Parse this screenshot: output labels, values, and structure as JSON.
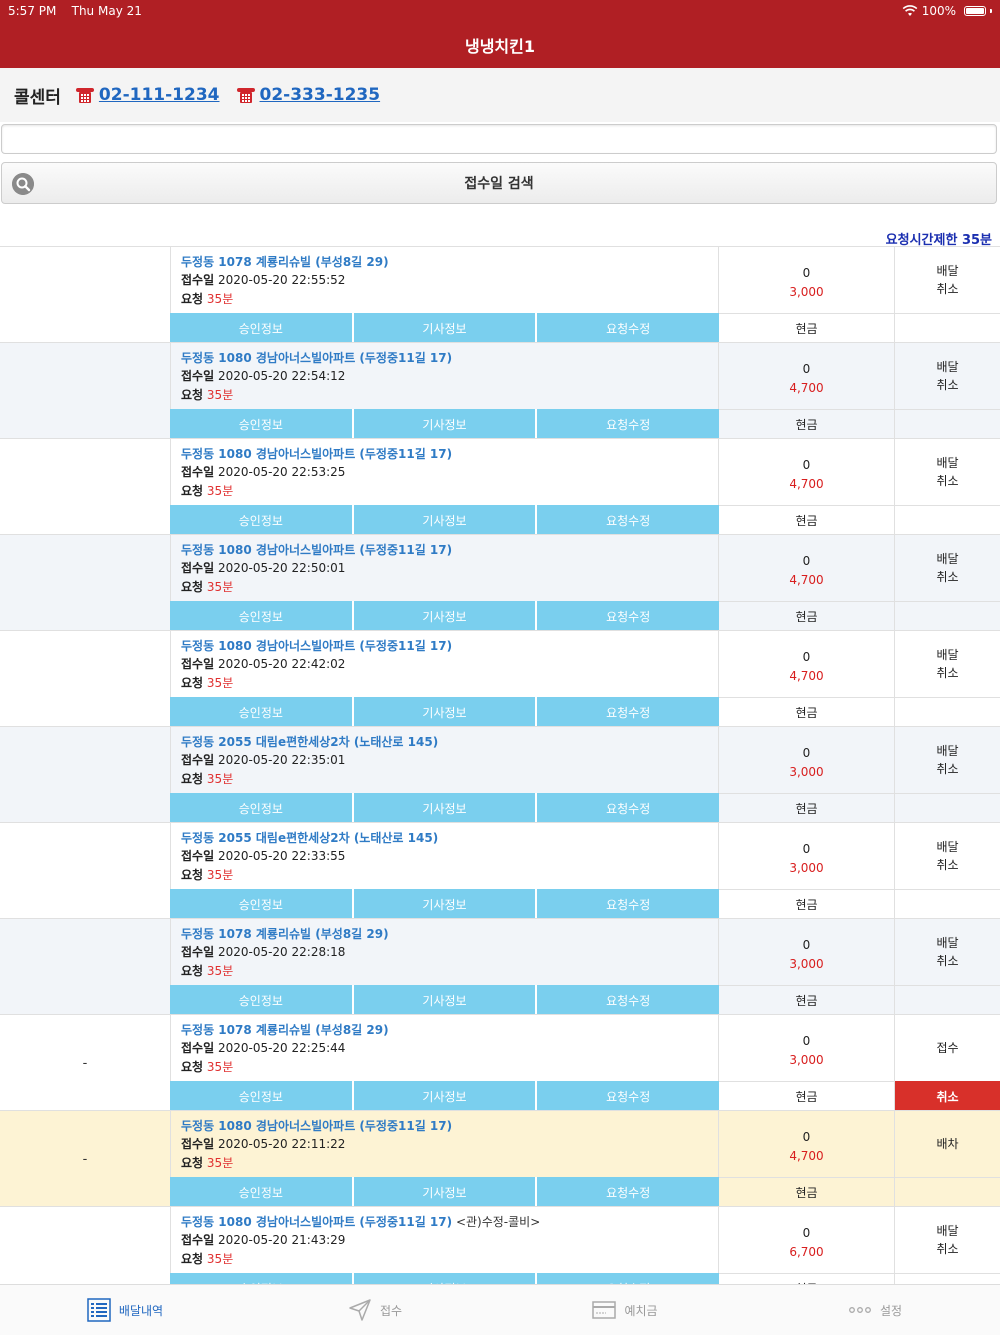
{
  "status_bar": {
    "time": "5:57 PM",
    "date": "Thu May 21",
    "battery": "100%"
  },
  "nav": {
    "title": "냉냉치킨1"
  },
  "call_center": {
    "label": "콜센터",
    "phones": [
      "02-111-1234",
      "02-333-1235"
    ]
  },
  "search": {
    "placeholder": "",
    "button_label": "접수일 검색"
  },
  "limit_notice": "요청시간제한 35분",
  "row_buttons": [
    "승인정보",
    "기사정보",
    "요청수정"
  ],
  "orders": [
    {
      "left": "",
      "addr": "두정동 1078 계룡리슈빌 (부성8길 29)",
      "note": "",
      "time_label": "접수일",
      "time": "2020-05-20 22:55:52",
      "req_label": "요청",
      "req": "35분",
      "qty": "0",
      "price": "3,000",
      "status1": "배달",
      "status2": "취소",
      "pay": "현금",
      "action": "",
      "bg": "white"
    },
    {
      "left": "",
      "addr": "두정동 1080 경남아너스빌아파트 (두정중11길 17)",
      "note": "",
      "time_label": "접수일",
      "time": "2020-05-20 22:54:12",
      "req_label": "요청",
      "req": "35분",
      "qty": "0",
      "price": "4,700",
      "status1": "배달",
      "status2": "취소",
      "pay": "현금",
      "action": "",
      "bg": "alt"
    },
    {
      "left": "",
      "addr": "두정동 1080 경남아너스빌아파트 (두정중11길 17)",
      "note": "",
      "time_label": "접수일",
      "time": "2020-05-20 22:53:25",
      "req_label": "요청",
      "req": "35분",
      "qty": "0",
      "price": "4,700",
      "status1": "배달",
      "status2": "취소",
      "pay": "현금",
      "action": "",
      "bg": "white"
    },
    {
      "left": "",
      "addr": "두정동 1080 경남아너스빌아파트 (두정중11길 17)",
      "note": "",
      "time_label": "접수일",
      "time": "2020-05-20 22:50:01",
      "req_label": "요청",
      "req": "35분",
      "qty": "0",
      "price": "4,700",
      "status1": "배달",
      "status2": "취소",
      "pay": "현금",
      "action": "",
      "bg": "alt"
    },
    {
      "left": "",
      "addr": "두정동 1080 경남아너스빌아파트 (두정중11길 17)",
      "note": "",
      "time_label": "접수일",
      "time": "2020-05-20 22:42:02",
      "req_label": "요청",
      "req": "35분",
      "qty": "0",
      "price": "4,700",
      "status1": "배달",
      "status2": "취소",
      "pay": "현금",
      "action": "",
      "bg": "white"
    },
    {
      "left": "",
      "addr": "두정동 2055 대림e편한세상2차 (노태산로 145)",
      "note": "",
      "time_label": "접수일",
      "time": "2020-05-20 22:35:01",
      "req_label": "요청",
      "req": "35분",
      "qty": "0",
      "price": "3,000",
      "status1": "배달",
      "status2": "취소",
      "pay": "현금",
      "action": "",
      "bg": "alt"
    },
    {
      "left": "",
      "addr": "두정동 2055 대림e편한세상2차 (노태산로 145)",
      "note": "",
      "time_label": "접수일",
      "time": "2020-05-20 22:33:55",
      "req_label": "요청",
      "req": "35분",
      "qty": "0",
      "price": "3,000",
      "status1": "배달",
      "status2": "취소",
      "pay": "현금",
      "action": "",
      "bg": "white"
    },
    {
      "left": "",
      "addr": "두정동 1078 계룡리슈빌 (부성8길 29)",
      "note": "",
      "time_label": "접수일",
      "time": "2020-05-20 22:28:18",
      "req_label": "요청",
      "req": "35분",
      "qty": "0",
      "price": "3,000",
      "status1": "배달",
      "status2": "취소",
      "pay": "현금",
      "action": "",
      "bg": "alt"
    },
    {
      "left": "-",
      "addr": "두정동 1078 계룡리슈빌 (부성8길 29)",
      "note": "",
      "time_label": "접수일",
      "time": "2020-05-20 22:25:44",
      "req_label": "요청",
      "req": "35분",
      "qty": "0",
      "price": "3,000",
      "status1": "접수",
      "status2": "",
      "pay": "현금",
      "action": "취소",
      "bg": "white"
    },
    {
      "left": "-",
      "addr": "두정동 1080 경남아너스빌아파트 (두정중11길 17)",
      "note": "",
      "time_label": "접수일",
      "time": "2020-05-20 22:11:22",
      "req_label": "요청",
      "req": "35분",
      "qty": "0",
      "price": "4,700",
      "status1": "배차",
      "status2": "",
      "pay": "현금",
      "action": "",
      "bg": "yellow"
    },
    {
      "left": "",
      "addr": "두정동 1080 경남아너스빌아파트 (두정중11길 17)",
      "note": " <관)수정-콜비>",
      "time_label": "접수일",
      "time": "2020-05-20 21:43:29",
      "req_label": "요청",
      "req": "35분",
      "qty": "0",
      "price": "6,700",
      "status1": "배달",
      "status2": "취소",
      "pay": "현금",
      "action": "",
      "bg": "white"
    }
  ],
  "tabs": [
    {
      "label": "배달내역",
      "icon": "list-icon",
      "active": true
    },
    {
      "label": "접수",
      "icon": "send-icon",
      "active": false
    },
    {
      "label": "예치금",
      "icon": "card-icon",
      "active": false
    },
    {
      "label": "설정",
      "icon": "more-icon",
      "active": false
    }
  ],
  "colors": {
    "brand": "#b01f24",
    "button": "#7acfee",
    "link": "#2f7bc5",
    "danger": "#d8302a"
  }
}
